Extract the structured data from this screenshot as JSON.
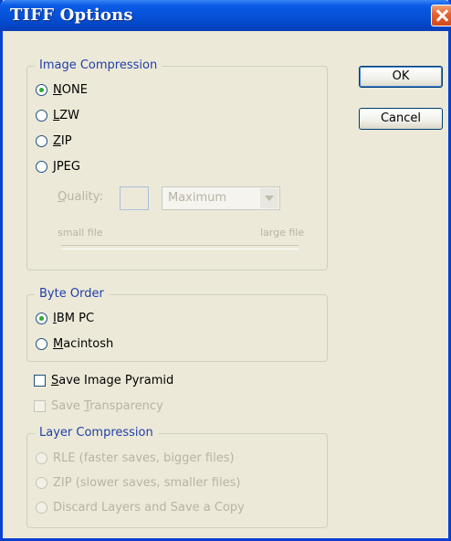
{
  "window": {
    "title": "TIFF Options"
  },
  "buttons": {
    "ok": "OK",
    "cancel": "Cancel"
  },
  "image_compression": {
    "legend": "Image Compression",
    "options": [
      {
        "accel": "N",
        "rest": "ONE",
        "selected": true
      },
      {
        "accel": "L",
        "rest": "ZW",
        "selected": false
      },
      {
        "accel": "Z",
        "rest": "IP",
        "selected": false
      },
      {
        "accel": "J",
        "rest": "PEG",
        "selected": false
      }
    ],
    "quality": {
      "accel": "Q",
      "rest": "uality:",
      "value": "",
      "preset": "Maximum"
    },
    "small_file": "small file",
    "large_file": "large file"
  },
  "byte_order": {
    "legend": "Byte Order",
    "options": [
      {
        "accel": "I",
        "rest": "BM PC",
        "selected": true
      },
      {
        "accel": "M",
        "rest": "acintosh",
        "selected": false
      }
    ]
  },
  "save_image_pyramid": {
    "accel": "S",
    "rest": "ave Image Pyramid",
    "checked": false
  },
  "save_transparency": {
    "pre": "Save ",
    "accel": "T",
    "rest": "ransparency",
    "checked": false
  },
  "layer_compression": {
    "legend": "Layer Compression",
    "options": [
      "RLE (faster saves, bigger files)",
      "ZIP (slower saves, smaller files)",
      "Discard Layers and Save a Copy"
    ]
  }
}
